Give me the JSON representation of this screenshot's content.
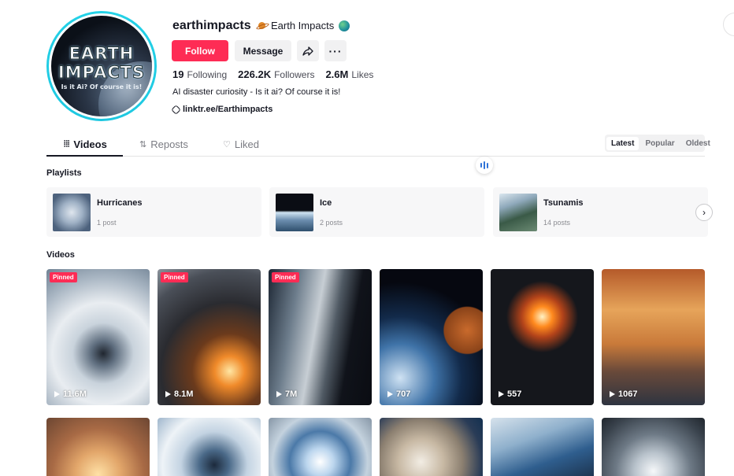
{
  "profile": {
    "avatar_text_line1": "EARTH",
    "avatar_text_line2": "IMPACTS",
    "avatar_text_line3": "Is it Ai? Of course it is!",
    "username": "earthimpacts",
    "nickname": "Earth Impacts",
    "follow_label": "Follow",
    "message_label": "Message",
    "stats": {
      "following_count": "19",
      "following_label": "Following",
      "followers_count": "226.2K",
      "followers_label": "Followers",
      "likes_count": "2.6M",
      "likes_label": "Likes"
    },
    "bio": "AI disaster curiosity - Is it ai? Of course it is!",
    "link": "linktr.ee/Earthimpacts"
  },
  "tabs": [
    {
      "label": "Videos",
      "icon": "grid-icon"
    },
    {
      "label": "Reposts",
      "icon": "repost-icon"
    },
    {
      "label": "Liked",
      "icon": "heart-icon"
    }
  ],
  "sort": [
    "Latest",
    "Popular",
    "Oldest"
  ],
  "sections": {
    "playlists_title": "Playlists",
    "videos_title": "Videos"
  },
  "playlists": [
    {
      "name": "Hurricanes",
      "count": "1 post"
    },
    {
      "name": "Ice",
      "count": "2 posts"
    },
    {
      "name": "Tsunamis",
      "count": "14 posts"
    }
  ],
  "pinned_label": "Pinned",
  "videos": [
    {
      "views": "11.6M",
      "pinned": true
    },
    {
      "views": "8.1M",
      "pinned": true
    },
    {
      "views": "7M",
      "pinned": true
    },
    {
      "views": "707",
      "pinned": false
    },
    {
      "views": "557",
      "pinned": false
    },
    {
      "views": "1067",
      "pinned": false
    }
  ],
  "colors": {
    "accent": "#fe2c55",
    "ring": "#25d3e8",
    "text": "#161823"
  }
}
